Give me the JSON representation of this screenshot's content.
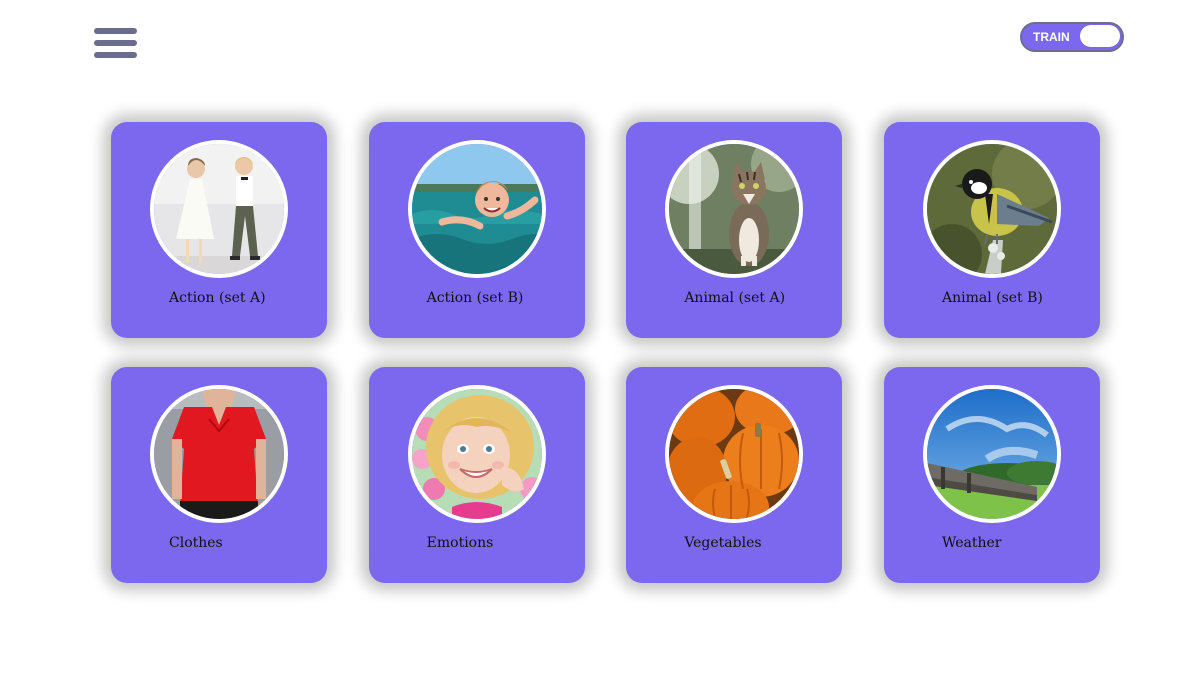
{
  "header": {
    "menu_icon": "hamburger-menu-icon",
    "mode_toggle": {
      "label": "TRAIN"
    }
  },
  "colors": {
    "card_bg": "#7b68ee",
    "icon_gray": "#6b6d8e",
    "page_bg": "#ffffff"
  },
  "categories": [
    {
      "label": "Action (set A)",
      "image": "children-dancing"
    },
    {
      "label": "Action (set B)",
      "image": "child-swimming"
    },
    {
      "label": "Animal (set A)",
      "image": "cat"
    },
    {
      "label": "Animal (set B)",
      "image": "bird-tit"
    },
    {
      "label": "Clothes",
      "image": "woman-red-blouse"
    },
    {
      "label": "Emotions",
      "image": "smiling-girl"
    },
    {
      "label": "Vegetables",
      "image": "pumpkins"
    },
    {
      "label": "Weather",
      "image": "blue-sky-landscape"
    }
  ]
}
